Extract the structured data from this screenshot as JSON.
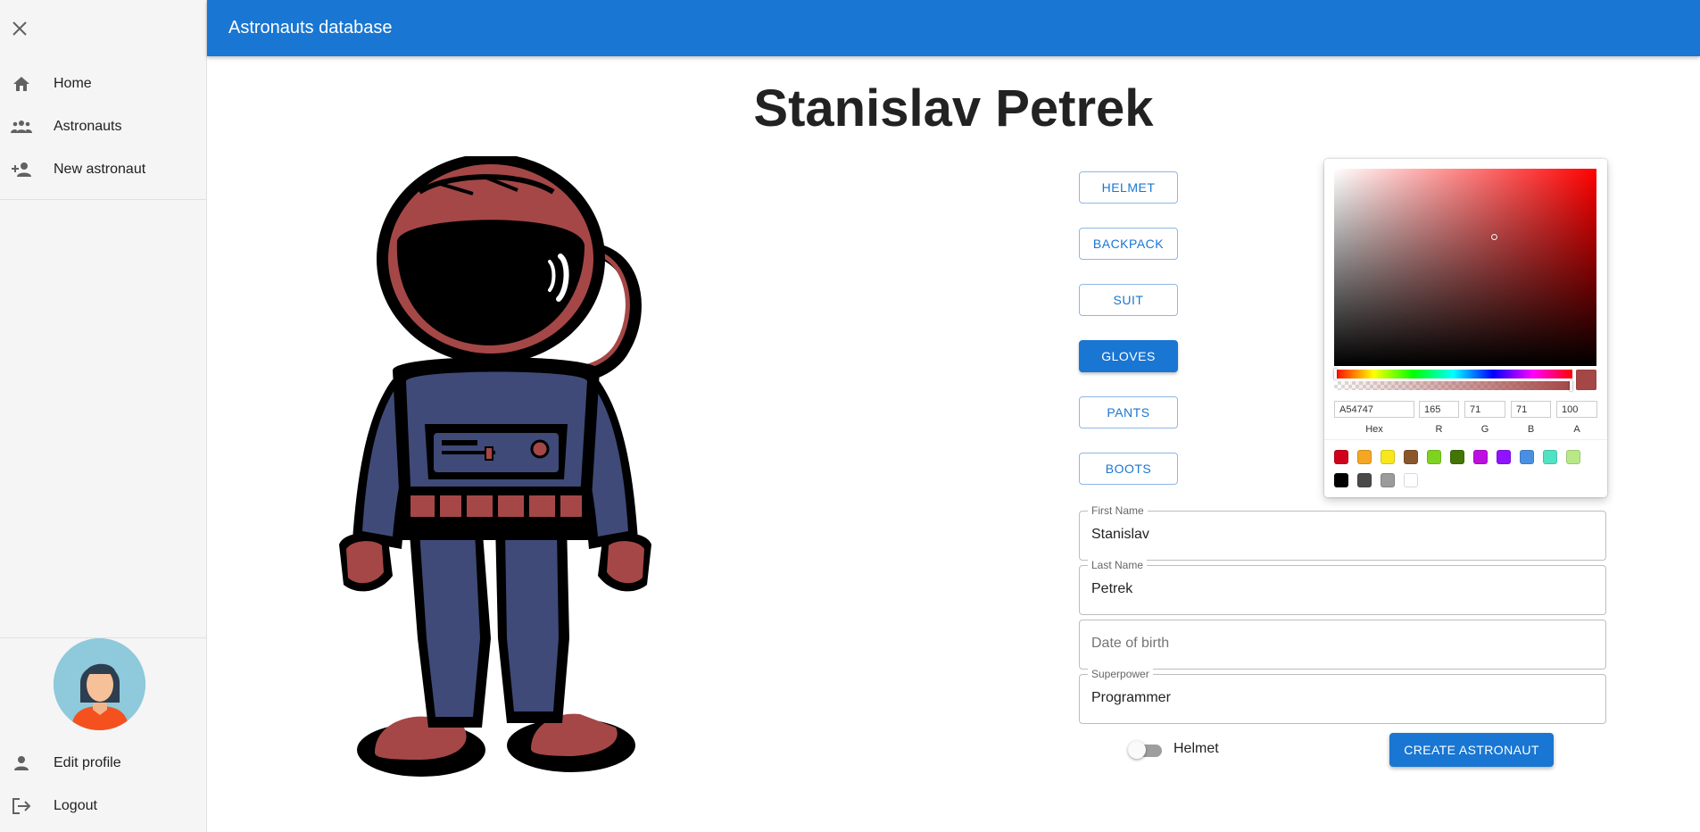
{
  "appbar": {
    "title": "Astronauts database"
  },
  "sidebar": {
    "items": [
      {
        "label": "Home",
        "icon": "home-icon"
      },
      {
        "label": "Astronauts",
        "icon": "group-icon"
      },
      {
        "label": "New astronaut",
        "icon": "person-add-icon"
      }
    ],
    "bottom_items": [
      {
        "label": "Edit profile",
        "icon": "person-icon"
      },
      {
        "label": "Logout",
        "icon": "logout-icon"
      }
    ]
  },
  "page": {
    "title": "Stanislav Petrek"
  },
  "parts": [
    "HELMET",
    "BACKPACK",
    "SUIT",
    "GLOVES",
    "PANTS",
    "BOOTS"
  ],
  "active_part": "GLOVES",
  "picker": {
    "hex": "A54747",
    "r": "165",
    "g": "71",
    "b": "71",
    "a": "100",
    "labels": {
      "hex": "Hex",
      "r": "R",
      "g": "G",
      "b": "B",
      "a": "A"
    },
    "current_color": "#A54747",
    "presets": [
      "#D0021B",
      "#F5A623",
      "#F8E71C",
      "#8B572A",
      "#7ED321",
      "#417505",
      "#BD10E0",
      "#9013FE",
      "#4A90E2",
      "#50E3C2",
      "#B8E986",
      "#000000",
      "#4A4A4A",
      "#9B9B9B",
      "#FFFFFF"
    ]
  },
  "form": {
    "first_name": {
      "label": "First Name",
      "value": "Stanislav"
    },
    "last_name": {
      "label": "Last Name",
      "value": "Petrek"
    },
    "date_of_birth": {
      "placeholder": "Date of birth",
      "value": ""
    },
    "superpower": {
      "label": "Superpower",
      "value": "Programmer"
    },
    "helmet_toggle": {
      "label": "Helmet",
      "checked": false
    },
    "submit_label": "CREATE ASTRONAUT"
  },
  "colors": {
    "primary": "#1976d2",
    "helmet": "#A54747",
    "suit": "#3F4A78",
    "avatar_bg": "#8ec9dc"
  }
}
